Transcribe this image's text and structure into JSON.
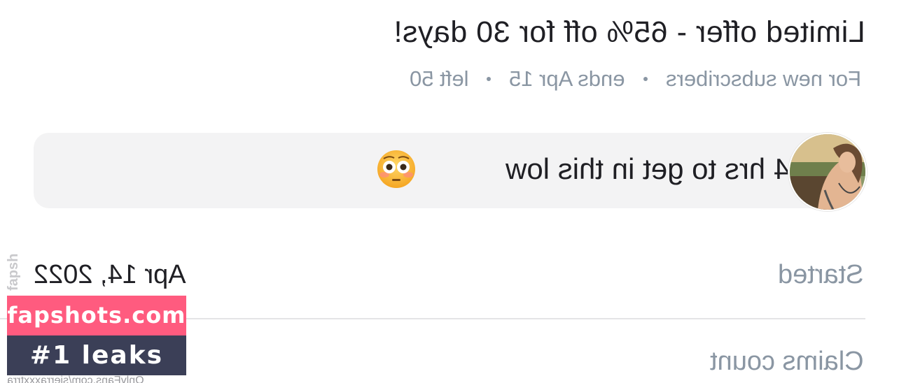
{
  "offer": {
    "title": "Limited offer - 65% off for 30 days!",
    "meta": [
      "For new subscribers",
      "ends Apr 15",
      "left 50"
    ]
  },
  "message": {
    "text": "24 hrs to get in this low",
    "emoji": "flushed-face-emoji",
    "avatar": "creator-avatar"
  },
  "details": {
    "started_label": "Started",
    "started_value": "Apr 14, 2022",
    "claims_label": "Claims count"
  },
  "watermark": {
    "side_text": "fapsh",
    "site": "fapshots.com",
    "tagline": "#1 leaks",
    "url": "OnlyFans.com/sierraxxxtrra"
  },
  "colors": {
    "text_primary": "#1f1f24",
    "text_secondary": "#8a96a3",
    "bubble_bg": "#f3f3f4",
    "watermark_pink": "#ff5b7f",
    "watermark_dark": "#3b3f57"
  }
}
